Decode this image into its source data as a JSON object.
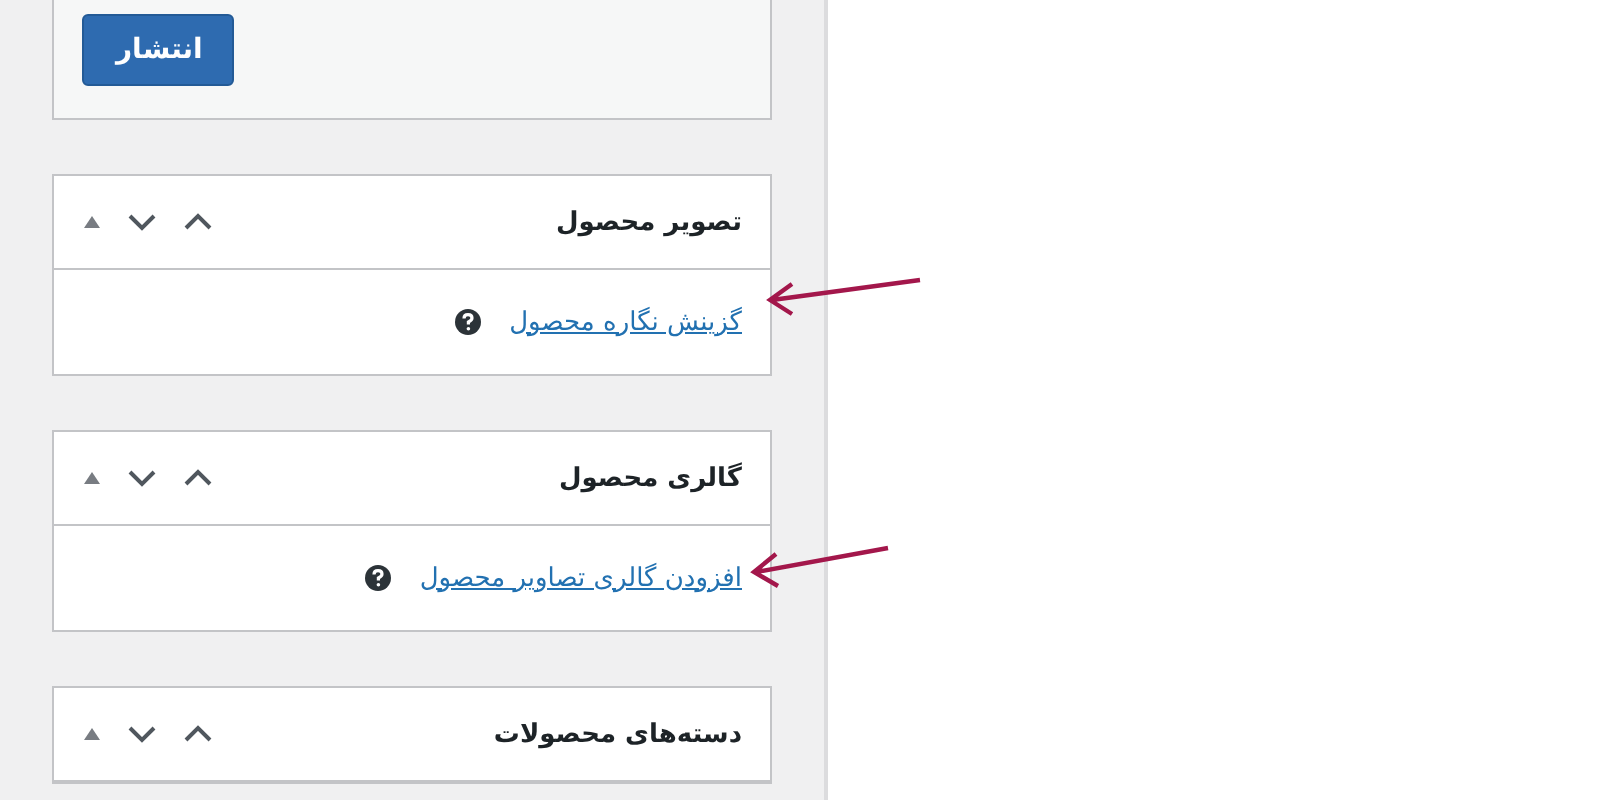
{
  "publish": {
    "button": "انتشار"
  },
  "boxes": [
    {
      "title": "تصویر محصول",
      "link": "گزینش نگاره محصول"
    },
    {
      "title": "گالری محصول",
      "link": "افزودن گالری تصاویر محصول"
    },
    {
      "title": "دسته‌های محصولات"
    }
  ]
}
